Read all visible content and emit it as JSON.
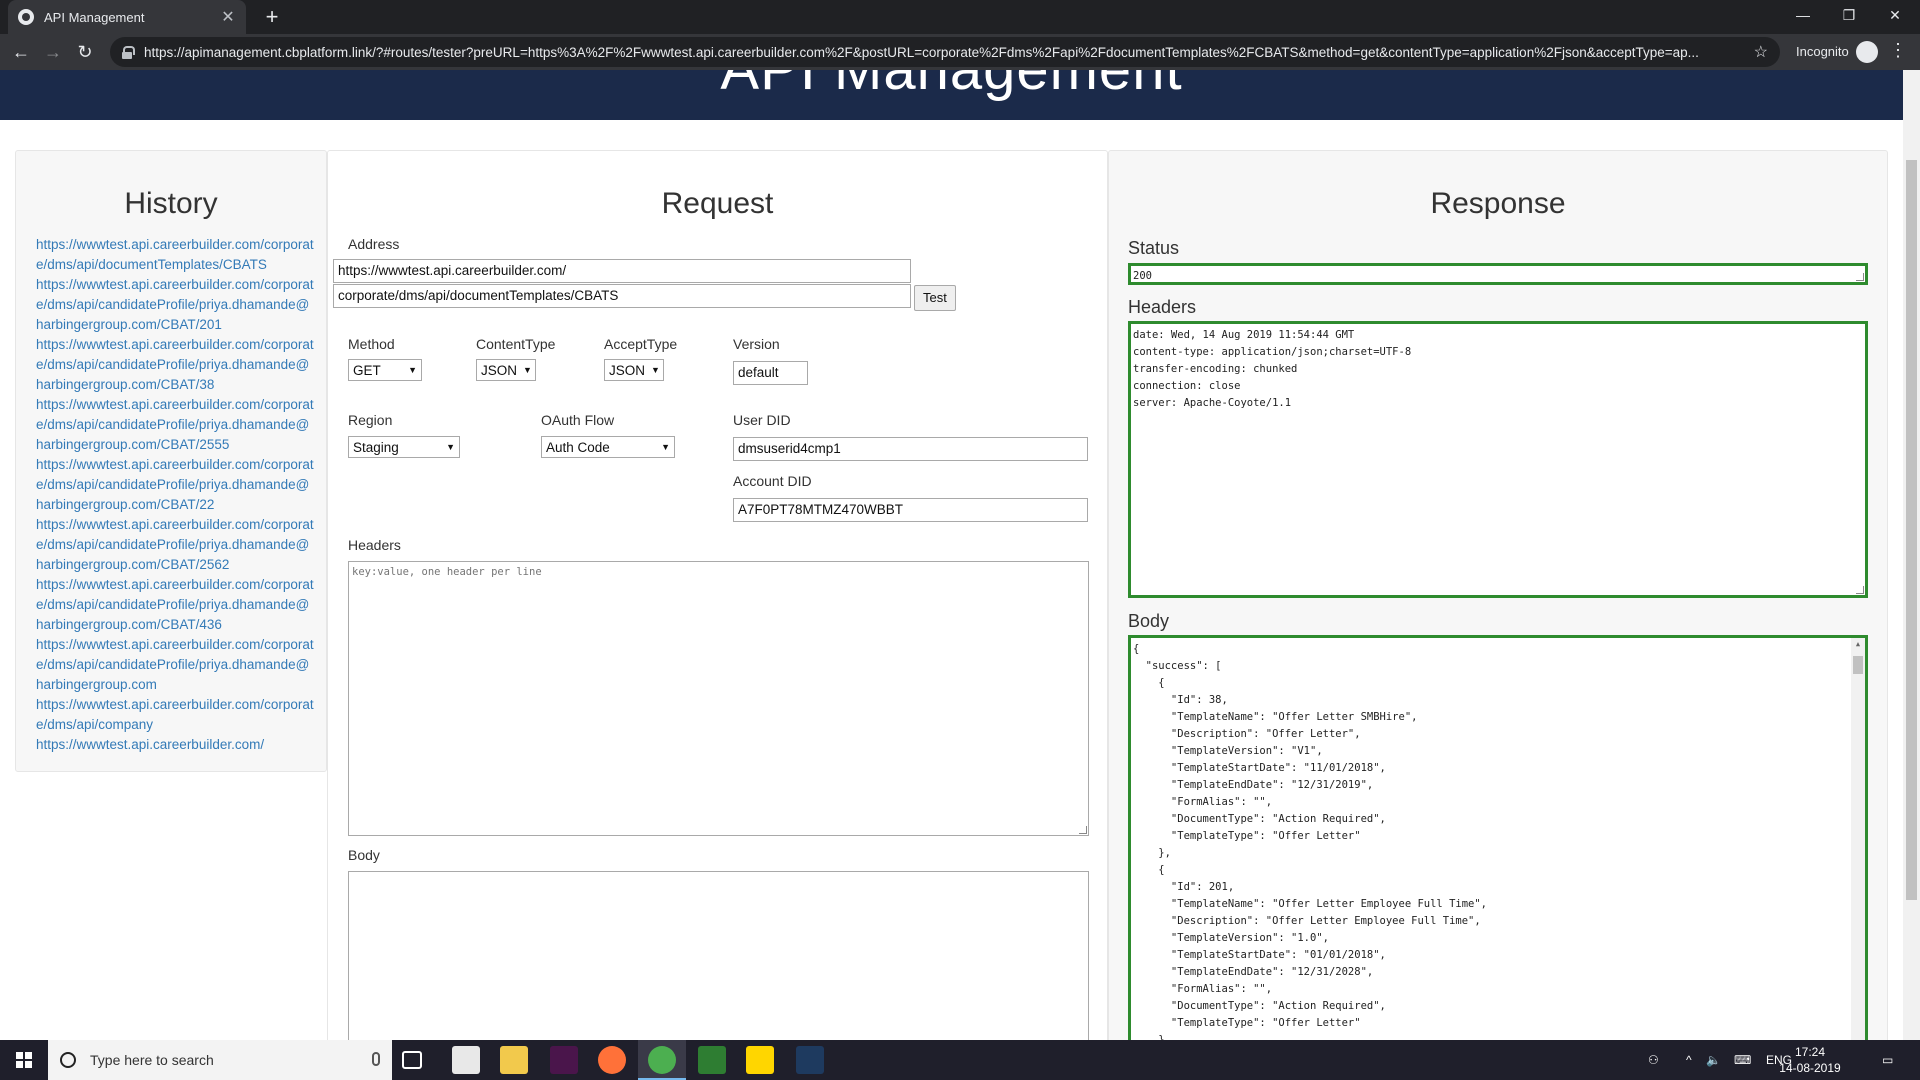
{
  "browser": {
    "tab_title": "API Management",
    "url": "https://apimanagement.cbplatform.link/?#routes/tester?preURL=https%3A%2F%2Fwwwtest.api.careerbuilder.com%2F&postURL=corporate%2Fdms%2Fapi%2FdocumentTemplates%2FCBATS&method=get&contentType=application%2Fjson&acceptType=ap...",
    "incognito_label": "Incognito"
  },
  "banner": {
    "title": "API Management"
  },
  "history": {
    "title": "History",
    "links": [
      "https://wwwtest.api.careerbuilder.com/corporate/dms/api/documentTemplates/CBATS",
      "https://wwwtest.api.careerbuilder.com/corporate/dms/api/candidateProfile/priya.dhamande@harbingergroup.com/CBAT/201",
      "https://wwwtest.api.careerbuilder.com/corporate/dms/api/candidateProfile/priya.dhamande@harbingergroup.com/CBAT/38",
      "https://wwwtest.api.careerbuilder.com/corporate/dms/api/candidateProfile/priya.dhamande@harbingergroup.com/CBAT/2555",
      "https://wwwtest.api.careerbuilder.com/corporate/dms/api/candidateProfile/priya.dhamande@harbingergroup.com/CBAT/22",
      "https://wwwtest.api.careerbuilder.com/corporate/dms/api/candidateProfile/priya.dhamande@harbingergroup.com/CBAT/2562",
      "https://wwwtest.api.careerbuilder.com/corporate/dms/api/candidateProfile/priya.dhamande@harbingergroup.com/CBAT/436",
      "https://wwwtest.api.careerbuilder.com/corporate/dms/api/candidateProfile/priya.dhamande@harbingergroup.com",
      "https://wwwtest.api.careerbuilder.com/corporate/dms/api/company",
      "https://wwwtest.api.careerbuilder.com/"
    ]
  },
  "request": {
    "title": "Request",
    "address_label": "Address",
    "pre_url": "https://wwwtest.api.careerbuilder.com/",
    "post_url": "corporate/dms/api/documentTemplates/CBATS",
    "test_button": "Test",
    "method_label": "Method",
    "method_value": "GET",
    "content_type_label": "ContentType",
    "content_type_value": "JSON",
    "accept_type_label": "AcceptType",
    "accept_type_value": "JSON",
    "version_label": "Version",
    "version_value": "default",
    "region_label": "Region",
    "region_value": "Staging",
    "oauth_label": "OAuth Flow",
    "oauth_value": "Auth Code",
    "user_did_label": "User DID",
    "user_did_value": "dmsuserid4cmp1",
    "account_did_label": "Account DID",
    "account_did_value": "A7F0PT78MTMZ470WBBT",
    "headers_label": "Headers",
    "headers_placeholder": "key:value, one header per line",
    "body_label": "Body"
  },
  "response": {
    "title": "Response",
    "status_label": "Status",
    "status_value": "200",
    "headers_label": "Headers",
    "headers_lines": [
      "date: Wed, 14 Aug 2019 11:54:44 GMT",
      "content-type: application/json;charset=UTF-8",
      "transfer-encoding: chunked",
      "connection: close",
      "server: Apache-Coyote/1.1"
    ],
    "body_label": "Body",
    "body_lines": [
      "{",
      "  \"success\": [",
      "    {",
      "      \"Id\": 38,",
      "      \"TemplateName\": \"Offer Letter SMBHire\",",
      "      \"Description\": \"Offer Letter\",",
      "      \"TemplateVersion\": \"V1\",",
      "      \"TemplateStartDate\": \"11/01/2018\",",
      "      \"TemplateEndDate\": \"12/31/2019\",",
      "      \"FormAlias\": \"\",",
      "      \"DocumentType\": \"Action Required\",",
      "      \"TemplateType\": \"Offer Letter\"",
      "    },",
      "    {",
      "      \"Id\": 201,",
      "      \"TemplateName\": \"Offer Letter Employee Full Time\",",
      "      \"Description\": \"Offer Letter Employee Full Time\",",
      "      \"TemplateVersion\": \"1.0\",",
      "      \"TemplateStartDate\": \"01/01/2018\",",
      "      \"TemplateEndDate\": \"12/31/2028\",",
      "      \"FormAlias\": \"\",",
      "      \"DocumentType\": \"Action Required\",",
      "      \"TemplateType\": \"Offer Letter\"",
      "    },"
    ],
    "accent_color": "#2e8b2e"
  },
  "taskbar": {
    "search_placeholder": "Type here to search",
    "language": "ENG",
    "time": "17:24",
    "date": "14-08-2019"
  }
}
